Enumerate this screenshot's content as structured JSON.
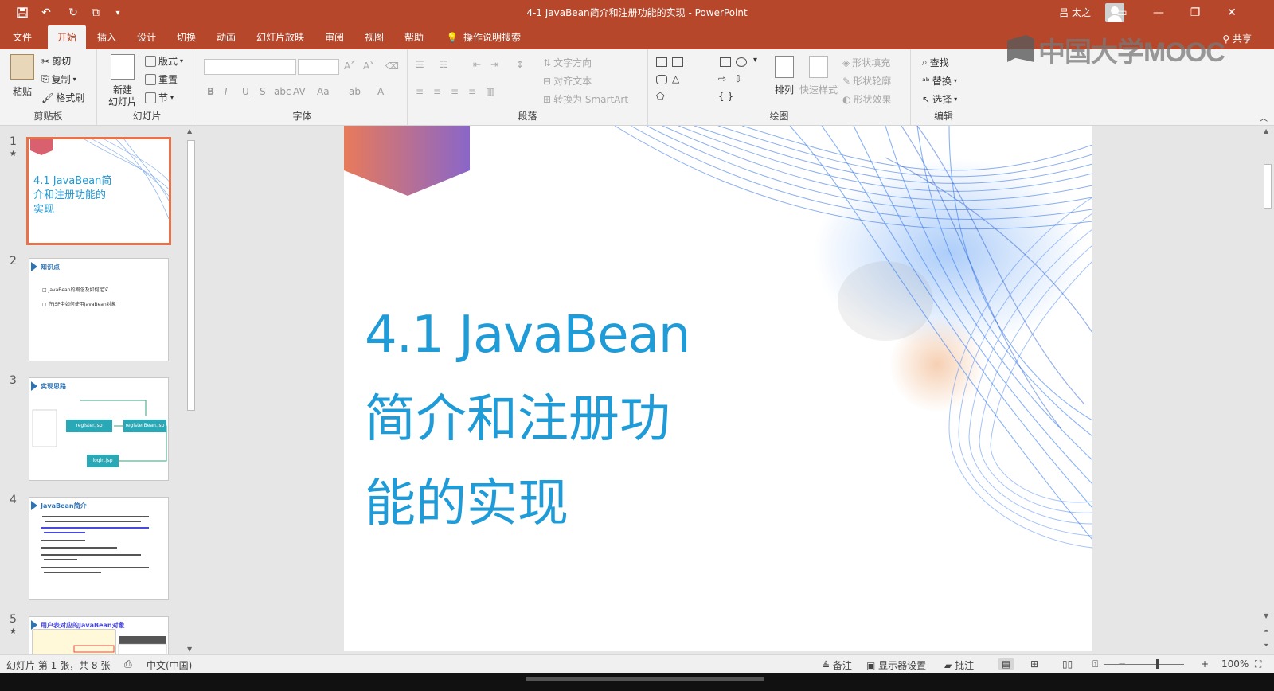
{
  "window": {
    "title": "4-1 JavaBean简介和注册功能的实现 - PowerPoint",
    "user": "吕 太之",
    "share_label": "共享",
    "watermark": "中国大学MOOC"
  },
  "quick_access": [
    "save-icon",
    "undo-icon",
    "redo-icon",
    "start-from-beginning-icon",
    "customize-icon"
  ],
  "tabs": [
    {
      "label": "文件"
    },
    {
      "label": "开始"
    },
    {
      "label": "插入"
    },
    {
      "label": "设计"
    },
    {
      "label": "切换"
    },
    {
      "label": "动画"
    },
    {
      "label": "幻灯片放映"
    },
    {
      "label": "审阅"
    },
    {
      "label": "视图"
    },
    {
      "label": "帮助"
    },
    {
      "label": "操作说明搜索"
    }
  ],
  "active_tab": "开始",
  "ribbon": {
    "clipboard": {
      "label": "剪贴板",
      "paste": "粘贴",
      "cut": "剪切",
      "copy": "复制",
      "format_painter": "格式刷"
    },
    "slides": {
      "label": "幻灯片",
      "new_slide": "新建\n幻灯片",
      "layout": "版式",
      "reset": "重置",
      "section": "节"
    },
    "font": {
      "label": "字体"
    },
    "paragraph": {
      "label": "段落",
      "text_direction": "文字方向",
      "align_text": "对齐文本",
      "smartart": "转换为 SmartArt"
    },
    "drawing": {
      "label": "绘图",
      "arrange": "排列",
      "quick_styles": "快速样式",
      "shape_fill": "形状填充",
      "shape_outline": "形状轮廓",
      "shape_effects": "形状效果"
    },
    "editing": {
      "label": "编辑",
      "find": "查找",
      "replace": "替换",
      "select": "选择"
    }
  },
  "thumbnails": [
    {
      "num": "1",
      "star": "★",
      "title": "4.1 JavaBean简介和注册功能的实现"
    },
    {
      "num": "2",
      "star": "",
      "title": "知识点",
      "bullets": [
        "JavaBean的概念及如何定义",
        "在JSP中如何使用JavaBean对象"
      ]
    },
    {
      "num": "3",
      "star": "",
      "title": "实现思路",
      "nodes": [
        "register.jsp",
        "registerBean.jsp",
        "login.jsp"
      ]
    },
    {
      "num": "4",
      "star": "",
      "title": "JavaBean简介"
    },
    {
      "num": "5",
      "star": "★",
      "title": "用户表对应的JavaBean对象"
    }
  ],
  "slide": {
    "title_line1": "4.1 JavaBean",
    "title_line2": "简介和注册功",
    "title_line3": "能的实现"
  },
  "statusbar": {
    "slide_info": "幻灯片 第 1 张，共 8 张",
    "language": "中文(中国)",
    "notes": "备注",
    "display_settings": "显示器设置",
    "comments": "批注",
    "zoom": "100%"
  },
  "colors": {
    "accent": "#b7472a",
    "title_blue": "#1f9bd7",
    "selected_border": "#e8734a"
  }
}
